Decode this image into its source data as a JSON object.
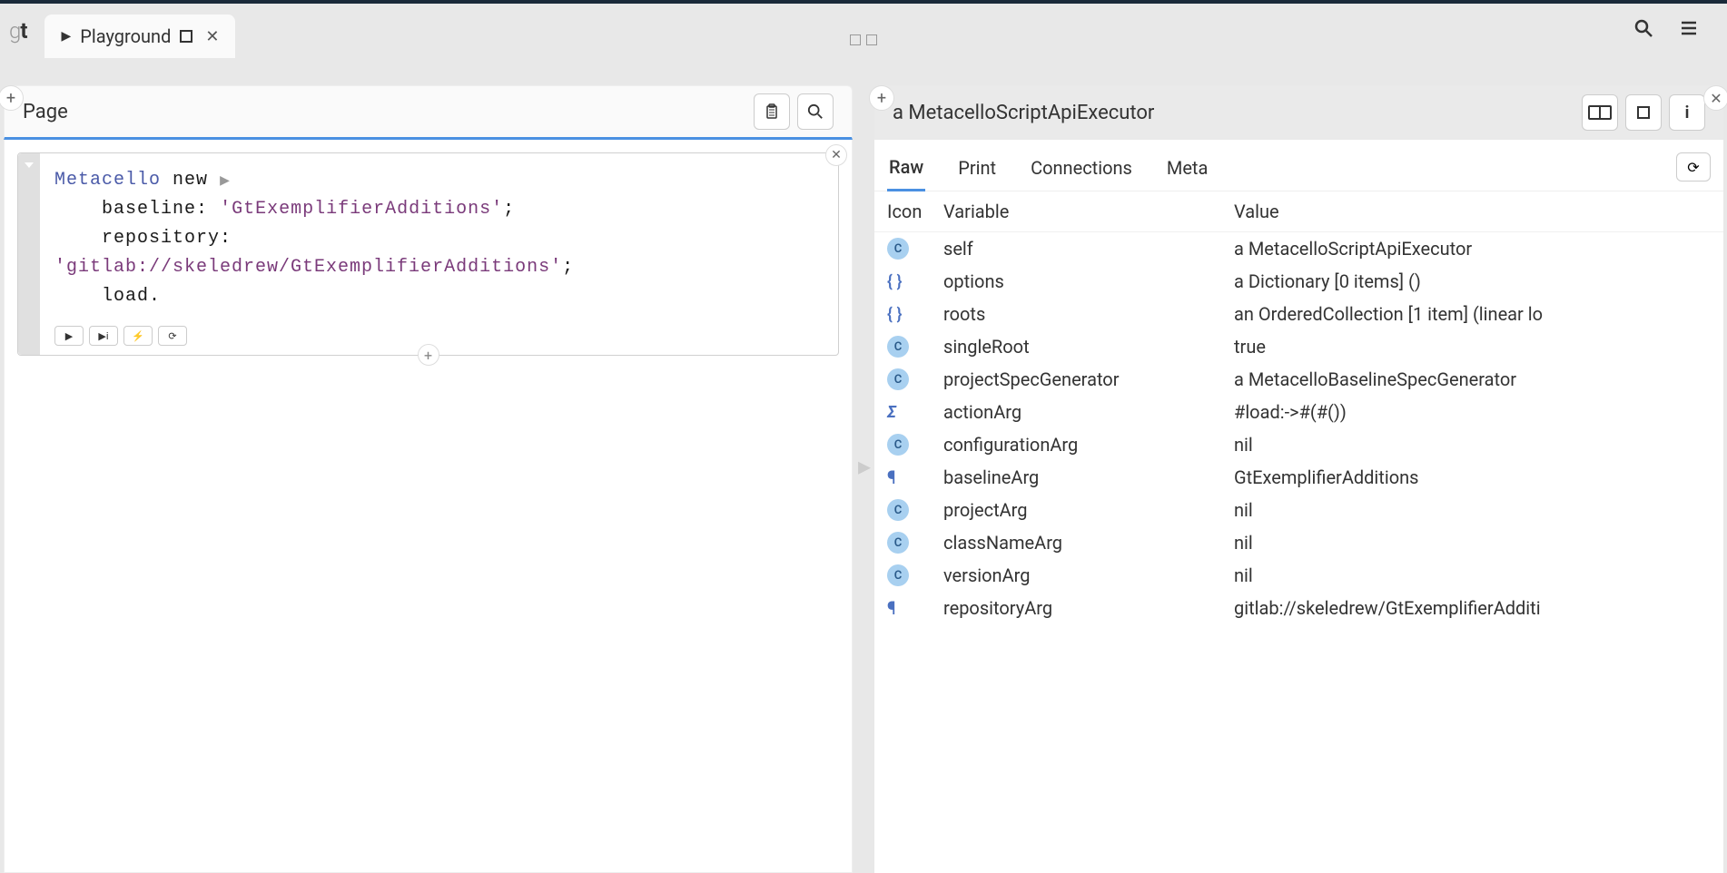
{
  "logo": {
    "prefix": "g",
    "bold": "t"
  },
  "tab": {
    "title": "Playground"
  },
  "leftPane": {
    "title": "Page",
    "code": {
      "line1_class": "Metacello",
      "line1_msg": " new",
      "line2_kw": "baseline:",
      "line2_str": "'GtExemplifierAdditions'",
      "line3_kw": "repository:",
      "line4_str": "'gitlab://skeledrew/GtExemplifierAdditions'",
      "line5_msg": "load."
    }
  },
  "rightPane": {
    "title": "a MetacelloScriptApiExecutor",
    "tabs": [
      "Raw",
      "Print",
      "Connections",
      "Meta"
    ],
    "columns": [
      "Icon",
      "Variable",
      "Value"
    ],
    "rows": [
      {
        "icon": "c",
        "variable": "self",
        "value": "a MetacelloScriptApiExecutor"
      },
      {
        "icon": "braces",
        "variable": "options",
        "value": "a Dictionary [0 items] ()"
      },
      {
        "icon": "braces",
        "variable": "roots",
        "value": "an OrderedCollection [1 item] (linear lo"
      },
      {
        "icon": "c",
        "variable": "singleRoot",
        "value": "true"
      },
      {
        "icon": "c",
        "variable": "projectSpecGenerator",
        "value": "a MetacelloBaselineSpecGenerator"
      },
      {
        "icon": "sigma",
        "variable": "actionArg",
        "value": "#load:->#(#())"
      },
      {
        "icon": "c",
        "variable": "configurationArg",
        "value": "nil"
      },
      {
        "icon": "para",
        "variable": "baselineArg",
        "value": "GtExemplifierAdditions"
      },
      {
        "icon": "c",
        "variable": "projectArg",
        "value": "nil"
      },
      {
        "icon": "c",
        "variable": "classNameArg",
        "value": "nil"
      },
      {
        "icon": "c",
        "variable": "versionArg",
        "value": "nil"
      },
      {
        "icon": "para",
        "variable": "repositoryArg",
        "value": "gitlab://skeledrew/GtExemplifierAdditi"
      }
    ]
  }
}
